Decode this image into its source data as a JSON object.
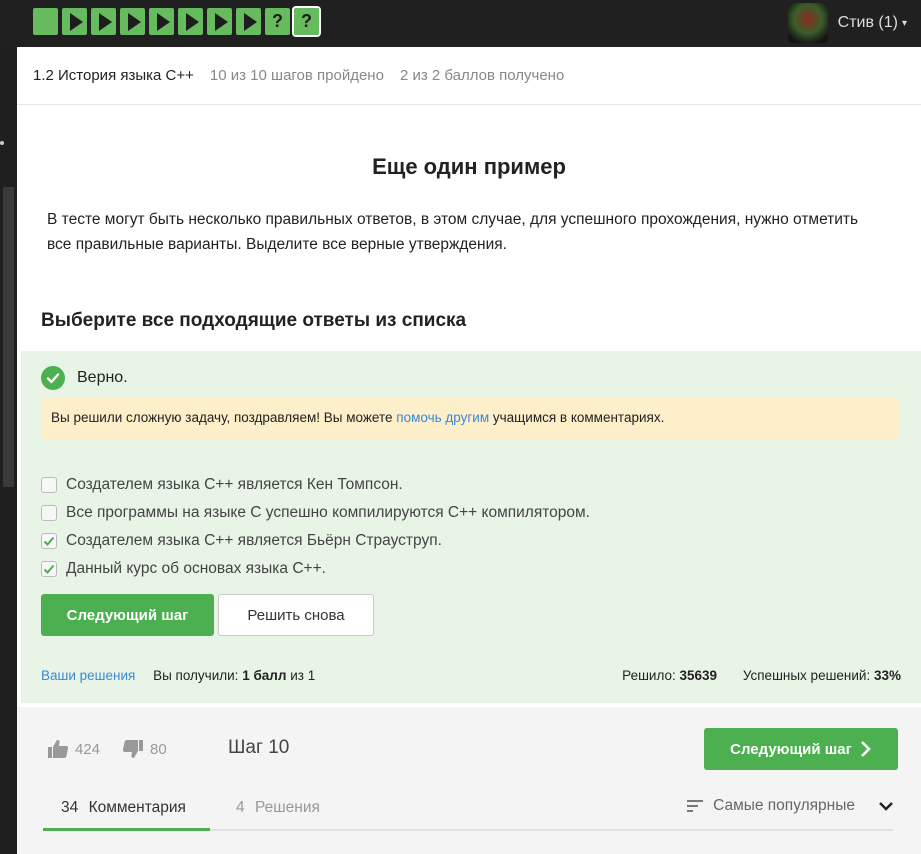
{
  "topbar": {
    "steps": [
      {
        "type": "done"
      },
      {
        "type": "play"
      },
      {
        "type": "play"
      },
      {
        "type": "play"
      },
      {
        "type": "play"
      },
      {
        "type": "play"
      },
      {
        "type": "play"
      },
      {
        "type": "play"
      },
      {
        "type": "quiz",
        "label": "?"
      },
      {
        "type": "quiz",
        "label": "?",
        "active": true
      }
    ],
    "user_name": "Стив (1)"
  },
  "lesson": {
    "title": "1.2 История языка C++",
    "steps_progress": "10 из 10 шагов пройдено",
    "points_progress": "2 из 2 баллов  получено"
  },
  "step": {
    "title": "Еще один пример",
    "description": "В тесте могут быть несколько правильных ответов, в этом случае, для успешного прохождения, нужно отметить все правильные варианты. Выделите все верные утверждения.",
    "question_heading": "Выберите все подходящие ответы из списка"
  },
  "result": {
    "verdict": "Верно.",
    "hint_before": "Вы решили сложную задачу, поздравляем! Вы можете ",
    "hint_link": "помочь другим",
    "hint_after": " учащимся в комментариях.",
    "options": [
      {
        "text": "Создателем языка C++ является Кен Томпсон.",
        "checked": false
      },
      {
        "text": "Все программы на языке C успешно компилируются C++ компилятором.",
        "checked": false
      },
      {
        "text": "Создателем языка C++ является Бьёрн Страуструп.",
        "checked": true
      },
      {
        "text": "Данный курс об основах языка C++.",
        "checked": true
      }
    ],
    "next_label": "Следующий шаг",
    "retry_label": "Решить снова",
    "your_solutions": "Ваши решения",
    "received_prefix": "Вы получили:",
    "received_value": "1 балл",
    "received_suffix": "из 1",
    "solved_label": "Решило:",
    "solved_value": "35639",
    "success_label": "Успешных решений:",
    "success_value": "33%"
  },
  "footer": {
    "likes": "424",
    "dislikes": "80",
    "step_label": "Шаг 10",
    "next_label": "Следующий шаг",
    "tabs": [
      {
        "count": "34",
        "label": "Комментария",
        "active": true
      },
      {
        "count": "4",
        "label": "Решения",
        "active": false
      }
    ],
    "sort_label": "Самые популярные"
  },
  "colors": {
    "accent": "#4caf50",
    "step_green": "#66bb5e",
    "result_bg": "#e8f5e6",
    "hint_bg": "#fcefc9",
    "link": "#3a87d8"
  },
  "icons": [
    "check-circle-icon",
    "thumbs-up-icon",
    "thumbs-down-icon",
    "chevron-right-icon",
    "sort-icon",
    "chevron-down-icon",
    "play-icon",
    "question-icon"
  ]
}
